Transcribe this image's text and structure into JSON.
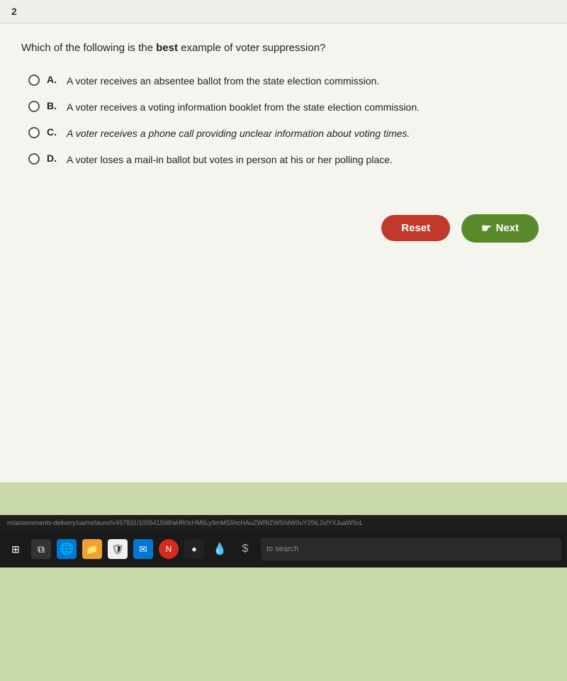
{
  "question": {
    "number": "2",
    "text_prefix": "Which of the following is the ",
    "text_bold": "best",
    "text_suffix": " example of voter suppression?",
    "options": [
      {
        "letter": "A.",
        "text": "A voter receives an absentee ballot from the state election commission.",
        "italic": false
      },
      {
        "letter": "B.",
        "text": "A voter receives a voting information booklet from the state election commission.",
        "italic": false
      },
      {
        "letter": "C.",
        "text": "A voter receives a phone call providing unclear information about voting times.",
        "italic": true
      },
      {
        "letter": "D.",
        "text": "A voter loses a mail-in ballot but votes in person at his or her polling place.",
        "italic": false
      }
    ]
  },
  "buttons": {
    "reset_label": "Reset",
    "next_label": "Next"
  },
  "taskbar": {
    "url": "m/assessments-delivery/ua/mt/launch/457831/100541598/aHR0cHM6Ly9mMS5hcHAuZWRtZW50dW0uY29tL2xlYXJuaW5nL",
    "search_placeholder": "to search"
  }
}
